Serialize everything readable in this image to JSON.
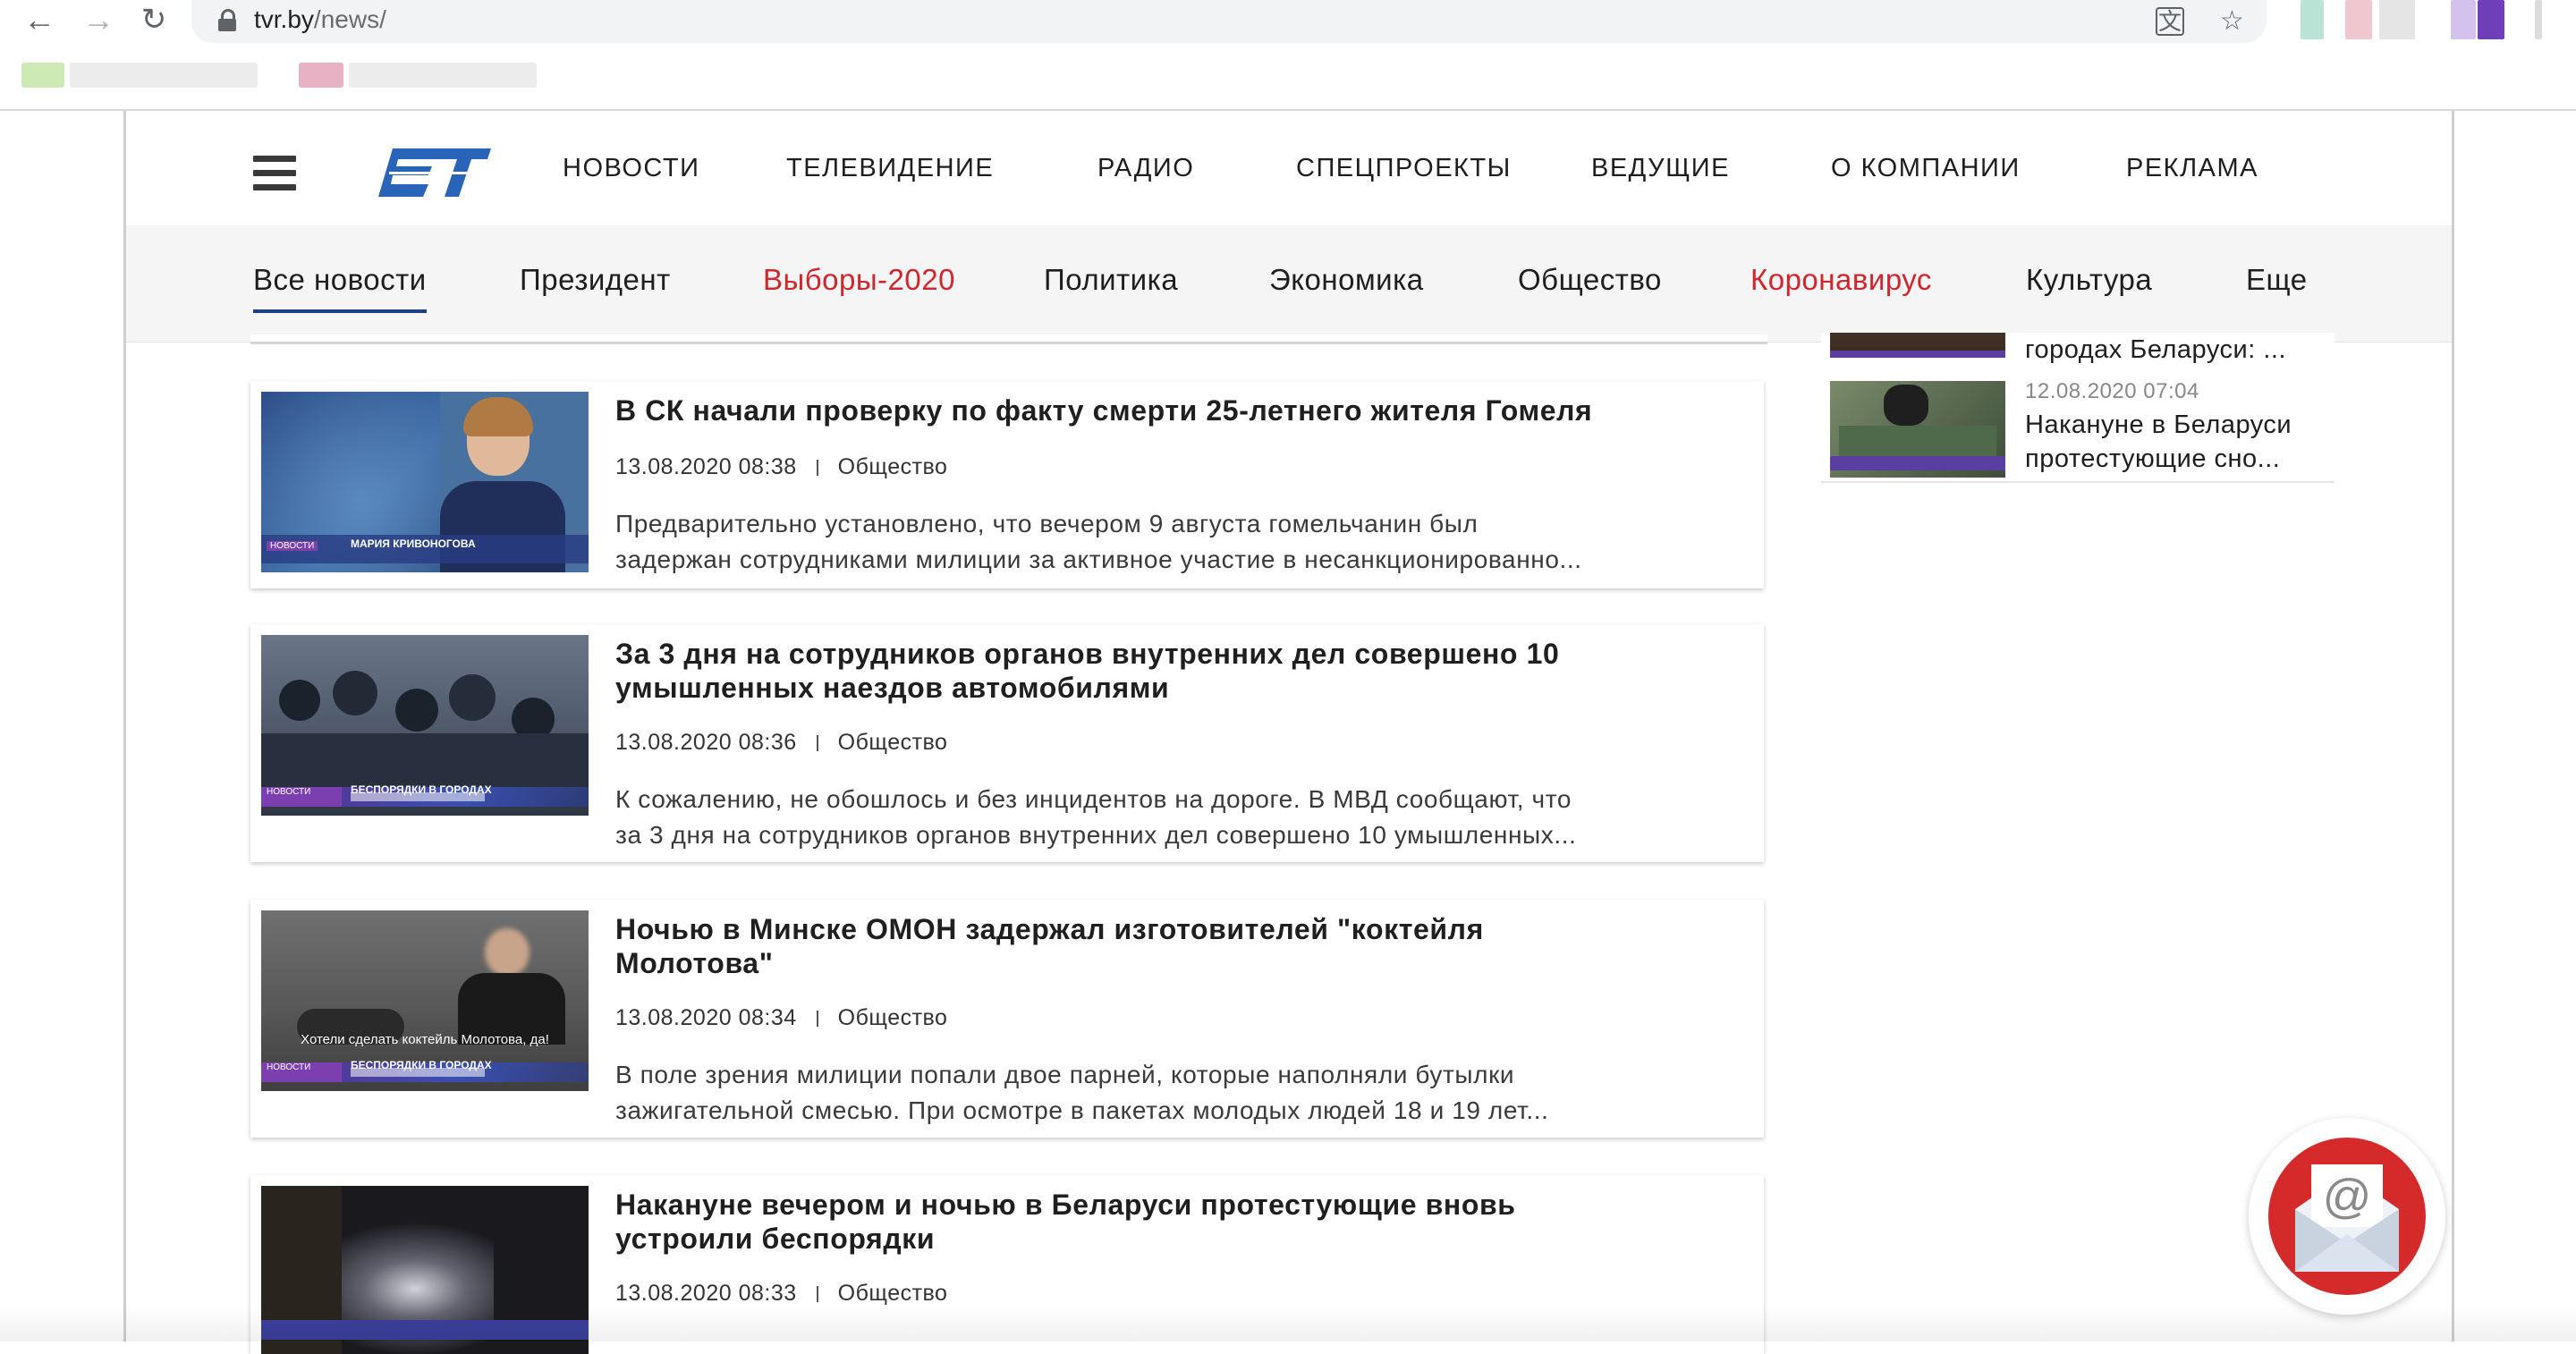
{
  "browser": {
    "url_host": "tvr.by",
    "url_path": "/news/"
  },
  "nav": {
    "items": [
      "НОВОСТИ",
      "ТЕЛЕВИДЕНИЕ",
      "РАДИО",
      "СПЕЦПРОЕКТЫ",
      "ВЕДУЩИЕ",
      "О КОМПАНИИ",
      "РЕКЛАМА"
    ]
  },
  "subnav": {
    "items": [
      {
        "label": "Все новости",
        "color": "#1e1e1e"
      },
      {
        "label": "Президент",
        "color": "#1e1e1e"
      },
      {
        "label": "Выборы-2020",
        "color": "#d1262b"
      },
      {
        "label": "Политика",
        "color": "#1e1e1e"
      },
      {
        "label": "Экономика",
        "color": "#1e1e1e"
      },
      {
        "label": "Общество",
        "color": "#1e1e1e"
      },
      {
        "label": "Коронавирус",
        "color": "#d1262b"
      },
      {
        "label": "Культура",
        "color": "#1e1e1e"
      },
      {
        "label": "Еще",
        "color": "#1e1e1e"
      }
    ],
    "active": "Все новости"
  },
  "articles": [
    {
      "title": "В СК начали проверку по факту смерти 25-летнего жителя Гомеля",
      "date": "13.08.2020 08:38",
      "category": "Общество",
      "excerpt_line1": "Предварительно установлено, что вечером 9 августа гомельчанин был",
      "excerpt_line2": "задержан сотрудниками милиции за активное участие в несанкционированно...",
      "thumb_caption": "МАРИЯ КРИВОНОГОВА",
      "thumb_tag": "НОВОСТИ"
    },
    {
      "title_line1": "За 3 дня на сотрудников органов внутренних дел совершено 10",
      "title_line2": "умышленных наездов автомобилями",
      "date": "13.08.2020 08:36",
      "category": "Общество",
      "excerpt_line1": "К сожалению, не обошлось и без инцидентов на дороге. В МВД сообщают, что",
      "excerpt_line2": "за 3 дня на сотрудников органов внутренних дел совершено 10 умышленных...",
      "thumb_caption": "БЕСПОРЯДКИ В ГОРОДАХ",
      "thumb_tag": "НОВОСТИ"
    },
    {
      "title_line1": "Ночью в Минске ОМОН задержал изготовителей \"коктейля",
      "title_line2": "Молотова\"",
      "date": "13.08.2020 08:34",
      "category": "Общество",
      "excerpt_line1": "В поле зрения милиции попали двое парней, которые наполняли бутылки",
      "excerpt_line2": "зажигательной смесью. При осмотре в пакетах молодых людей 18 и 19 лет...",
      "thumb_subtitle": "Хотели сделать коктейль Молотова, да!",
      "thumb_caption": "БЕСПОРЯДКИ В ГОРОДАХ",
      "thumb_tag": "НОВОСТИ"
    },
    {
      "title_line1": "Накануне вечером и ночью в Беларуси протестующие вновь",
      "title_line2": "устроили беспорядки",
      "date": "13.08.2020 08:33",
      "category": "Общество"
    }
  ],
  "sidebar": [
    {
      "title": "городах Беларуси: ..."
    },
    {
      "date": "12.08.2020 07:04",
      "title_line1": "Накануне в Беларуси",
      "title_line2": "протестующие сно..."
    }
  ],
  "colors": {
    "accent_red": "#d1262b",
    "active_underline": "#1f3e86",
    "logo_blue": "#2a64b8"
  },
  "icons": {
    "back": "arrow-left-icon",
    "forward": "arrow-right-icon",
    "reload": "reload-icon",
    "lock": "lock-icon",
    "translate": "translate-icon",
    "bookmark": "star-icon",
    "menu": "hamburger-icon",
    "mail": "mail-at-icon"
  }
}
